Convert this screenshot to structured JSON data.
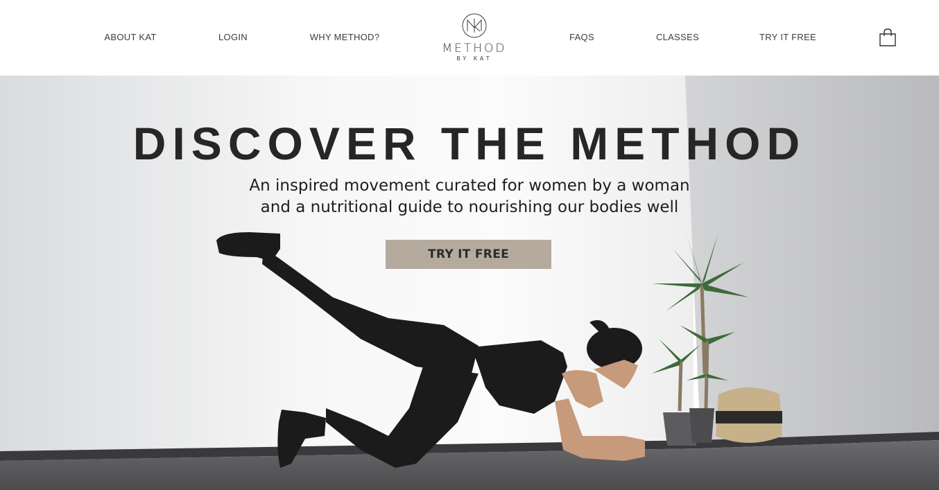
{
  "nav": {
    "left": [
      "ABOUT KAT",
      "LOGIN",
      "WHY METHOD?"
    ],
    "right": [
      "FAQS",
      "CLASSES",
      "TRY IT FREE"
    ]
  },
  "logo": {
    "word": "METHOD",
    "sub": "BY KAT",
    "icon": "monogram-circle-icon"
  },
  "cart": {
    "icon": "shopping-bag-icon"
  },
  "hero": {
    "title": "DISCOVER THE METHOD",
    "subtitle_line1": "An inspired movement curated for women by a woman",
    "subtitle_line2": "and a nutritional guide to nourishing our bodies well",
    "cta": "TRY IT FREE"
  },
  "colors": {
    "cta_bg": "#b5aa9e",
    "title": "#262626",
    "nav_text": "#3c3c3c"
  }
}
